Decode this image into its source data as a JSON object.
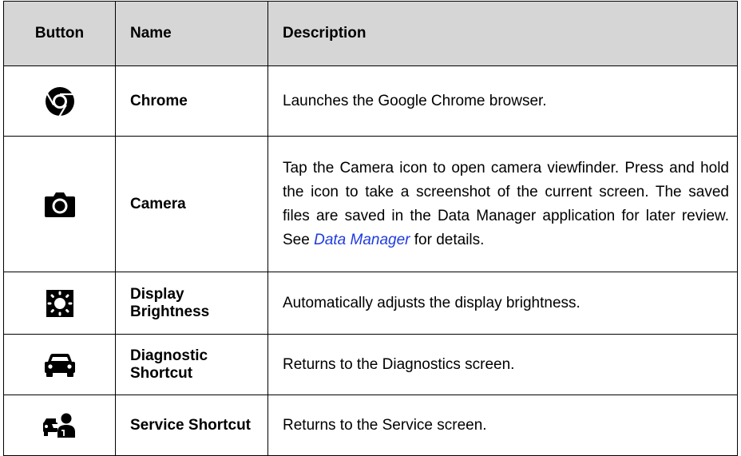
{
  "table": {
    "headers": [
      "Button",
      "Name",
      "Description"
    ],
    "rows": [
      {
        "icon": "chrome-icon",
        "name": "Chrome",
        "description": "Launches the Google Chrome browser."
      },
      {
        "icon": "camera-icon",
        "name": "Camera",
        "description_parts": [
          "Tap the Camera icon to open camera viewfinder. Press and hold the icon to take a screenshot of the current screen. The saved files are saved in the Data Manager application for later review. See ",
          "Data Manager",
          " for details."
        ]
      },
      {
        "icon": "brightness-icon",
        "name": "Display Brightness",
        "description": "Automatically adjusts the display brightness."
      },
      {
        "icon": "car-icon",
        "name": "Diagnostic Shortcut",
        "description": "Returns to the Diagnostics screen."
      },
      {
        "icon": "service-shortcut-icon",
        "name": "Service Shortcut",
        "description": "Returns to the Service screen."
      }
    ]
  }
}
